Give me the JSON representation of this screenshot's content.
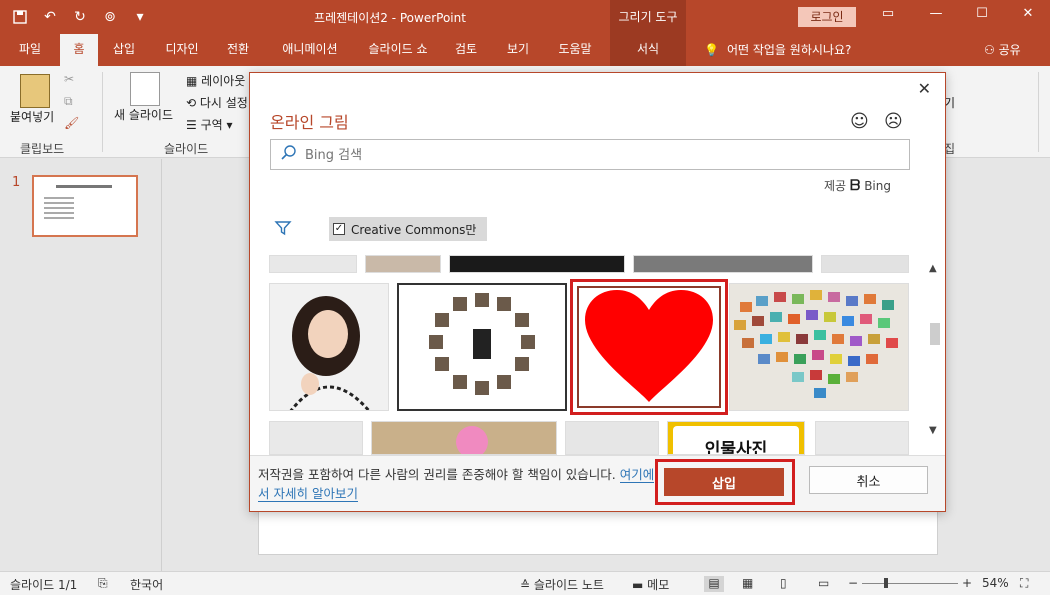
{
  "app": {
    "document_title": "프레젠테이션2  -  PowerPoint",
    "context_tab_header": "그리기 도구",
    "login_label": "로그인"
  },
  "qat": {
    "icons": [
      "save-icon",
      "undo-icon",
      "redo-icon",
      "present-icon",
      "customize-icon"
    ]
  },
  "tabs": [
    "파일",
    "홈",
    "삽입",
    "디자인",
    "전환",
    "애니메이션",
    "슬라이드 쇼",
    "검토",
    "보기",
    "도움말",
    "서식"
  ],
  "active_tab": "홈",
  "tell_me": "어떤 작업을 원하시나요?",
  "share": "공유",
  "ribbon": {
    "paste": "붙여넣기",
    "clipboard_group": "클립보드",
    "new_slide": "새 슬라이드",
    "layout": "레이아웃",
    "reset": "다시 설정",
    "section": "구역",
    "slides_group": "슬라이드",
    "right_label_1": "기",
    "right_label_2": "집"
  },
  "thumbnail": {
    "number": "1"
  },
  "dialog": {
    "title": "온라인 그림",
    "search_placeholder": "Bing 검색",
    "provided_by": "제공",
    "bing": "Bing",
    "creative_commons": "Creative Commons만",
    "notice_text": "저작권을 포함하여 다른 사람의 권리를 존중해야 할 책임이 있습니다.",
    "learn_more": "여기에서 자세히 알아보기",
    "insert": "삽입",
    "cancel": "취소",
    "featured_tile_text": "인물사진"
  },
  "statusbar": {
    "slide_count": "슬라이드 1/1",
    "language": "한국어",
    "notes": "슬라이드 노트",
    "comments": "메모",
    "zoom": "54%"
  },
  "colors": {
    "accent": "#b7472a",
    "selection": "#d21e1e",
    "heart": "#ff0000"
  }
}
